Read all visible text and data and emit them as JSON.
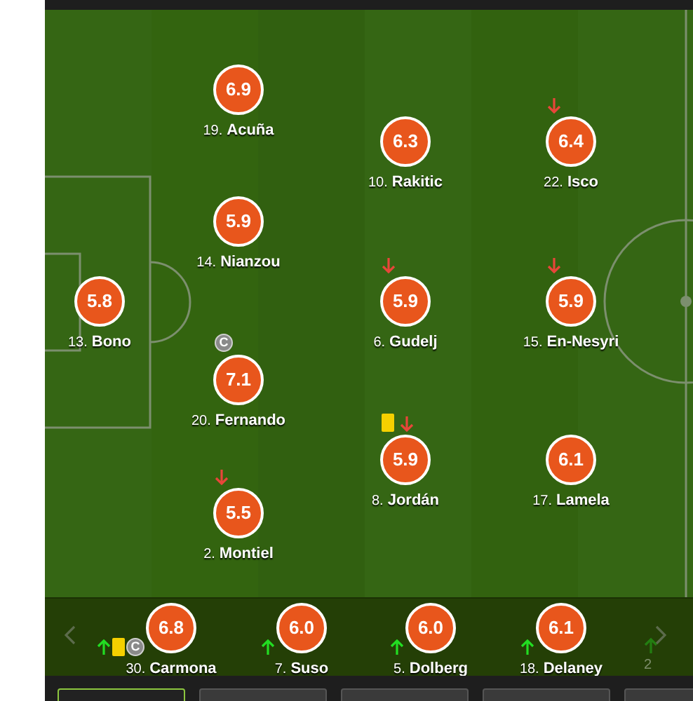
{
  "lineup": [
    {
      "number": "19.",
      "name": "Acuña",
      "rating": "6.9",
      "substituted": false,
      "booked": false,
      "captain": false
    },
    {
      "number": "10.",
      "name": "Rakitic",
      "rating": "6.3",
      "substituted": false,
      "booked": false,
      "captain": false
    },
    {
      "number": "22.",
      "name": "Isco",
      "rating": "6.4",
      "substituted": true,
      "booked": false,
      "captain": false
    },
    {
      "number": "14.",
      "name": "Nianzou",
      "rating": "5.9",
      "substituted": false,
      "booked": false,
      "captain": false
    },
    {
      "number": "13.",
      "name": "Bono",
      "rating": "5.8",
      "substituted": false,
      "booked": false,
      "captain": false
    },
    {
      "number": "6.",
      "name": "Gudelj",
      "rating": "5.9",
      "substituted": true,
      "booked": false,
      "captain": false
    },
    {
      "number": "15.",
      "name": "En-Nesyri",
      "rating": "5.9",
      "substituted": true,
      "booked": false,
      "captain": false
    },
    {
      "number": "20.",
      "name": "Fernando",
      "rating": "7.1",
      "substituted": false,
      "booked": false,
      "captain": true,
      "captain_label": "C"
    },
    {
      "number": "8.",
      "name": "Jordán",
      "rating": "5.9",
      "substituted": true,
      "booked": true,
      "captain": false
    },
    {
      "number": "17.",
      "name": "Lamela",
      "rating": "6.1",
      "substituted": false,
      "booked": false,
      "captain": false
    },
    {
      "number": "2.",
      "name": "Montiel",
      "rating": "5.5",
      "substituted": true,
      "booked": false,
      "captain": false
    }
  ],
  "bench": [
    {
      "number": "30.",
      "name": "Carmona",
      "rating": "6.8",
      "substituted": true,
      "booked": true,
      "captain": true,
      "captain_label": "C"
    },
    {
      "number": "7.",
      "name": "Suso",
      "rating": "6.0",
      "substituted": true,
      "booked": false,
      "captain": false
    },
    {
      "number": "5.",
      "name": "Dolberg",
      "rating": "6.0",
      "substituted": true,
      "booked": false,
      "captain": false
    },
    {
      "number": "18.",
      "name": "Delaney",
      "rating": "6.1",
      "substituted": true,
      "booked": false,
      "captain": false
    }
  ],
  "bench_cut_off": {
    "number": "2",
    "substituted": true
  },
  "tabs": [
    {
      "selected": true
    },
    {
      "selected": false
    },
    {
      "selected": false
    },
    {
      "selected": false
    },
    {
      "selected": false
    }
  ]
}
